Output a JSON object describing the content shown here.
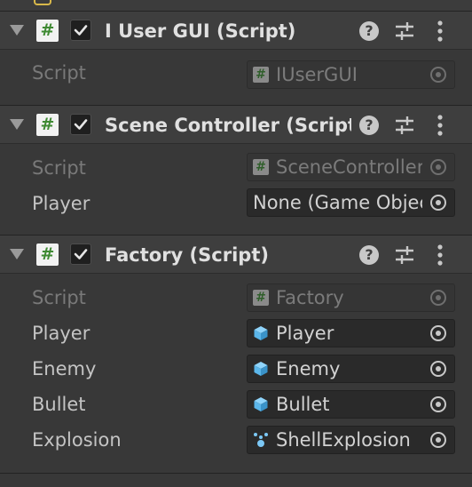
{
  "components": [
    {
      "title": "I User GUI (Script)",
      "enabled": true,
      "fields": [
        {
          "label": "Script",
          "value": "IUserGUI",
          "icon": "script-icon",
          "disabled": true
        }
      ]
    },
    {
      "title": "Scene Controller (Script)",
      "enabled": true,
      "fields": [
        {
          "label": "Script",
          "value": "SceneController",
          "icon": "script-icon",
          "disabled": true
        },
        {
          "label": "Player",
          "value": "None (Game Object)",
          "icon": "none",
          "disabled": false
        }
      ]
    },
    {
      "title": "Factory (Script)",
      "enabled": true,
      "fields": [
        {
          "label": "Script",
          "value": "Factory",
          "icon": "script-icon",
          "disabled": true
        },
        {
          "label": "Player",
          "value": "Player",
          "icon": "prefab-cube-icon",
          "disabled": false
        },
        {
          "label": "Enemy",
          "value": "Enemy",
          "icon": "prefab-cube-icon",
          "disabled": false
        },
        {
          "label": "Bullet",
          "value": "Bullet",
          "icon": "prefab-cube-icon",
          "disabled": false
        },
        {
          "label": "Explosion",
          "value": "ShellExplosion",
          "icon": "particle-system-icon",
          "disabled": false
        }
      ]
    }
  ],
  "icons": {
    "help": "?",
    "script_glyph": "#"
  },
  "colors": {
    "background": "#383838",
    "header": "#3e3e3e",
    "script_icon_green": "#3f8a33",
    "prefab_blue": "#5bb6ea"
  }
}
